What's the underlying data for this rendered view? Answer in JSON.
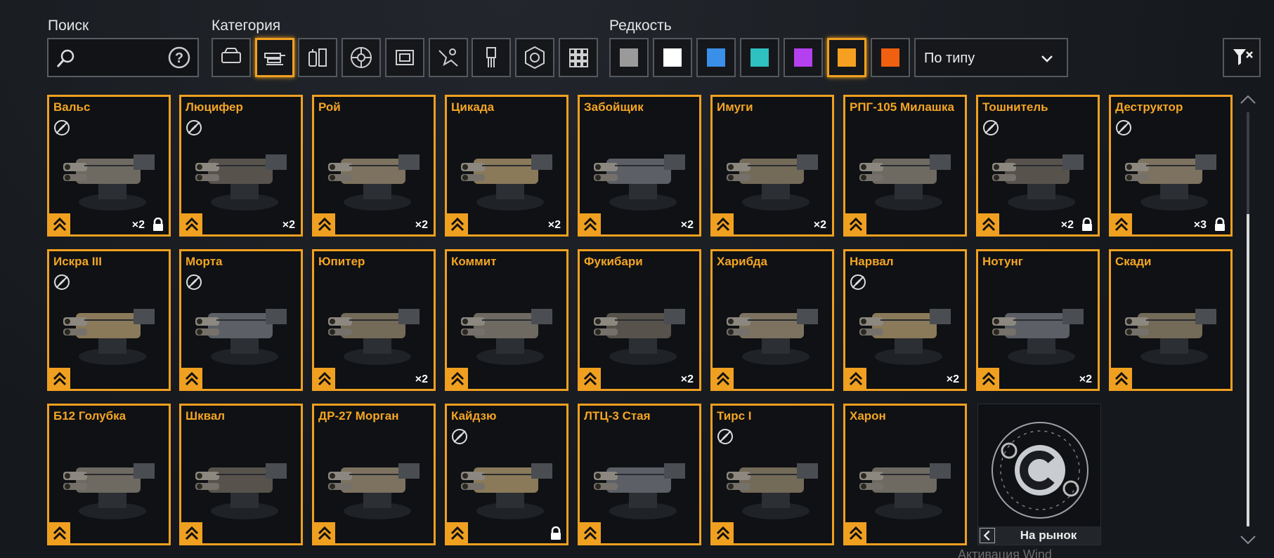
{
  "filters": {
    "search_label": "Поиск",
    "category_label": "Категория",
    "rarity_label": "Редкость",
    "sort_value": "По типу"
  },
  "categories": [
    {
      "name": "car-icon"
    },
    {
      "name": "weapon-icon",
      "selected": true
    },
    {
      "name": "equipment-icon"
    },
    {
      "name": "wheel-icon"
    },
    {
      "name": "frame-icon"
    },
    {
      "name": "decor-icon"
    },
    {
      "name": "paint-brush-icon"
    },
    {
      "name": "resources-icon"
    },
    {
      "name": "grid-icon"
    }
  ],
  "rarities": [
    {
      "name": "common",
      "color": "#9a9a9a"
    },
    {
      "name": "uncommon",
      "color": "#ffffff"
    },
    {
      "name": "rare",
      "color": "#3a8fe8"
    },
    {
      "name": "special",
      "color": "#2fc0c0"
    },
    {
      "name": "epic",
      "color": "#b440f0"
    },
    {
      "name": "legendary",
      "color": "#f5a020",
      "selected": true
    },
    {
      "name": "relic",
      "color": "#f06010"
    }
  ],
  "items": [
    {
      "name": "Вальс",
      "count": "×2",
      "locked": true,
      "noicon": true
    },
    {
      "name": "Люцифер",
      "count": "×2",
      "locked": false,
      "noicon": true
    },
    {
      "name": "Рой",
      "count": "×2",
      "locked": false,
      "noicon": false
    },
    {
      "name": "Цикада",
      "count": "×2",
      "locked": false,
      "noicon": false
    },
    {
      "name": "Забойщик",
      "count": "×2",
      "locked": false,
      "noicon": false
    },
    {
      "name": "Имуги",
      "count": "×2",
      "locked": false,
      "noicon": false
    },
    {
      "name": "РПГ-105 Милашка",
      "count": "",
      "locked": false,
      "noicon": false
    },
    {
      "name": "Тошнитель",
      "count": "×2",
      "locked": true,
      "noicon": true
    },
    {
      "name": "Деструктор",
      "count": "×3",
      "locked": true,
      "noicon": true
    },
    {
      "name": "Искра III",
      "count": "",
      "locked": false,
      "noicon": true
    },
    {
      "name": "Морта",
      "count": "",
      "locked": false,
      "noicon": true
    },
    {
      "name": "Юпитер",
      "count": "×2",
      "locked": false,
      "noicon": false
    },
    {
      "name": "Коммит",
      "count": "",
      "locked": false,
      "noicon": false
    },
    {
      "name": "Фукибари",
      "count": "×2",
      "locked": false,
      "noicon": false
    },
    {
      "name": "Харибда",
      "count": "",
      "locked": false,
      "noicon": false
    },
    {
      "name": "Нарвал",
      "count": "×2",
      "locked": false,
      "noicon": true
    },
    {
      "name": "Нотунг",
      "count": "×2",
      "locked": false,
      "noicon": false
    },
    {
      "name": "Скади",
      "count": "",
      "locked": false,
      "noicon": false
    },
    {
      "name": "Б12 Голубка",
      "count": "",
      "locked": false,
      "noicon": false
    },
    {
      "name": "Шквал",
      "count": "",
      "locked": false,
      "noicon": false
    },
    {
      "name": "ДР-27 Морган",
      "count": "",
      "locked": false,
      "noicon": false
    },
    {
      "name": "Кайдзю",
      "count": "",
      "locked": true,
      "noicon": true
    },
    {
      "name": "ЛТЦ-3 Стая",
      "count": "",
      "locked": false,
      "noicon": false
    },
    {
      "name": "Тирс I",
      "count": "",
      "locked": false,
      "noicon": true
    },
    {
      "name": "Харон",
      "count": "",
      "locked": false,
      "noicon": false
    }
  ],
  "market": {
    "label": "На рынок"
  },
  "watermark": "Активация Wind"
}
